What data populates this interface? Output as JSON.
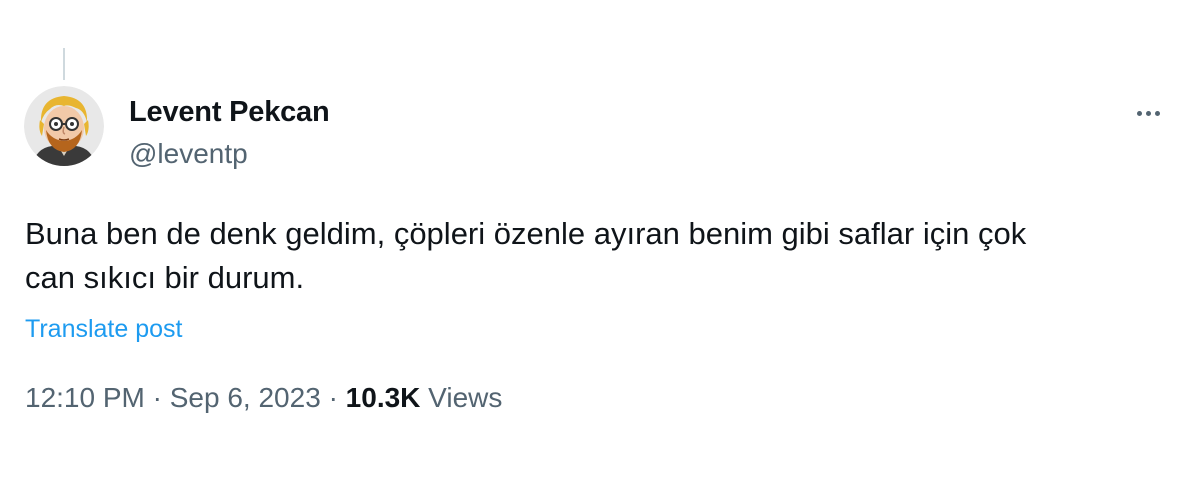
{
  "author": {
    "display_name": "Levent Pekcan",
    "handle": "@leventp"
  },
  "more_icon": "more-horizontal-icon",
  "tweet": {
    "text_line1": "Buna ben de denk geldim, çöpleri özenle ayıran benim gibi saflar için çok",
    "text_line2": "can sıkıcı bir durum.",
    "translate_label": "Translate post"
  },
  "meta": {
    "time": "12:10 PM",
    "separator": "·",
    "date": "Sep 6, 2023",
    "views_count": "10.3K",
    "views_label": "Views"
  },
  "colors": {
    "text_primary": "#0f1419",
    "text_secondary": "#536471",
    "link": "#1d9bf0",
    "thread_line": "#cfd9de"
  }
}
